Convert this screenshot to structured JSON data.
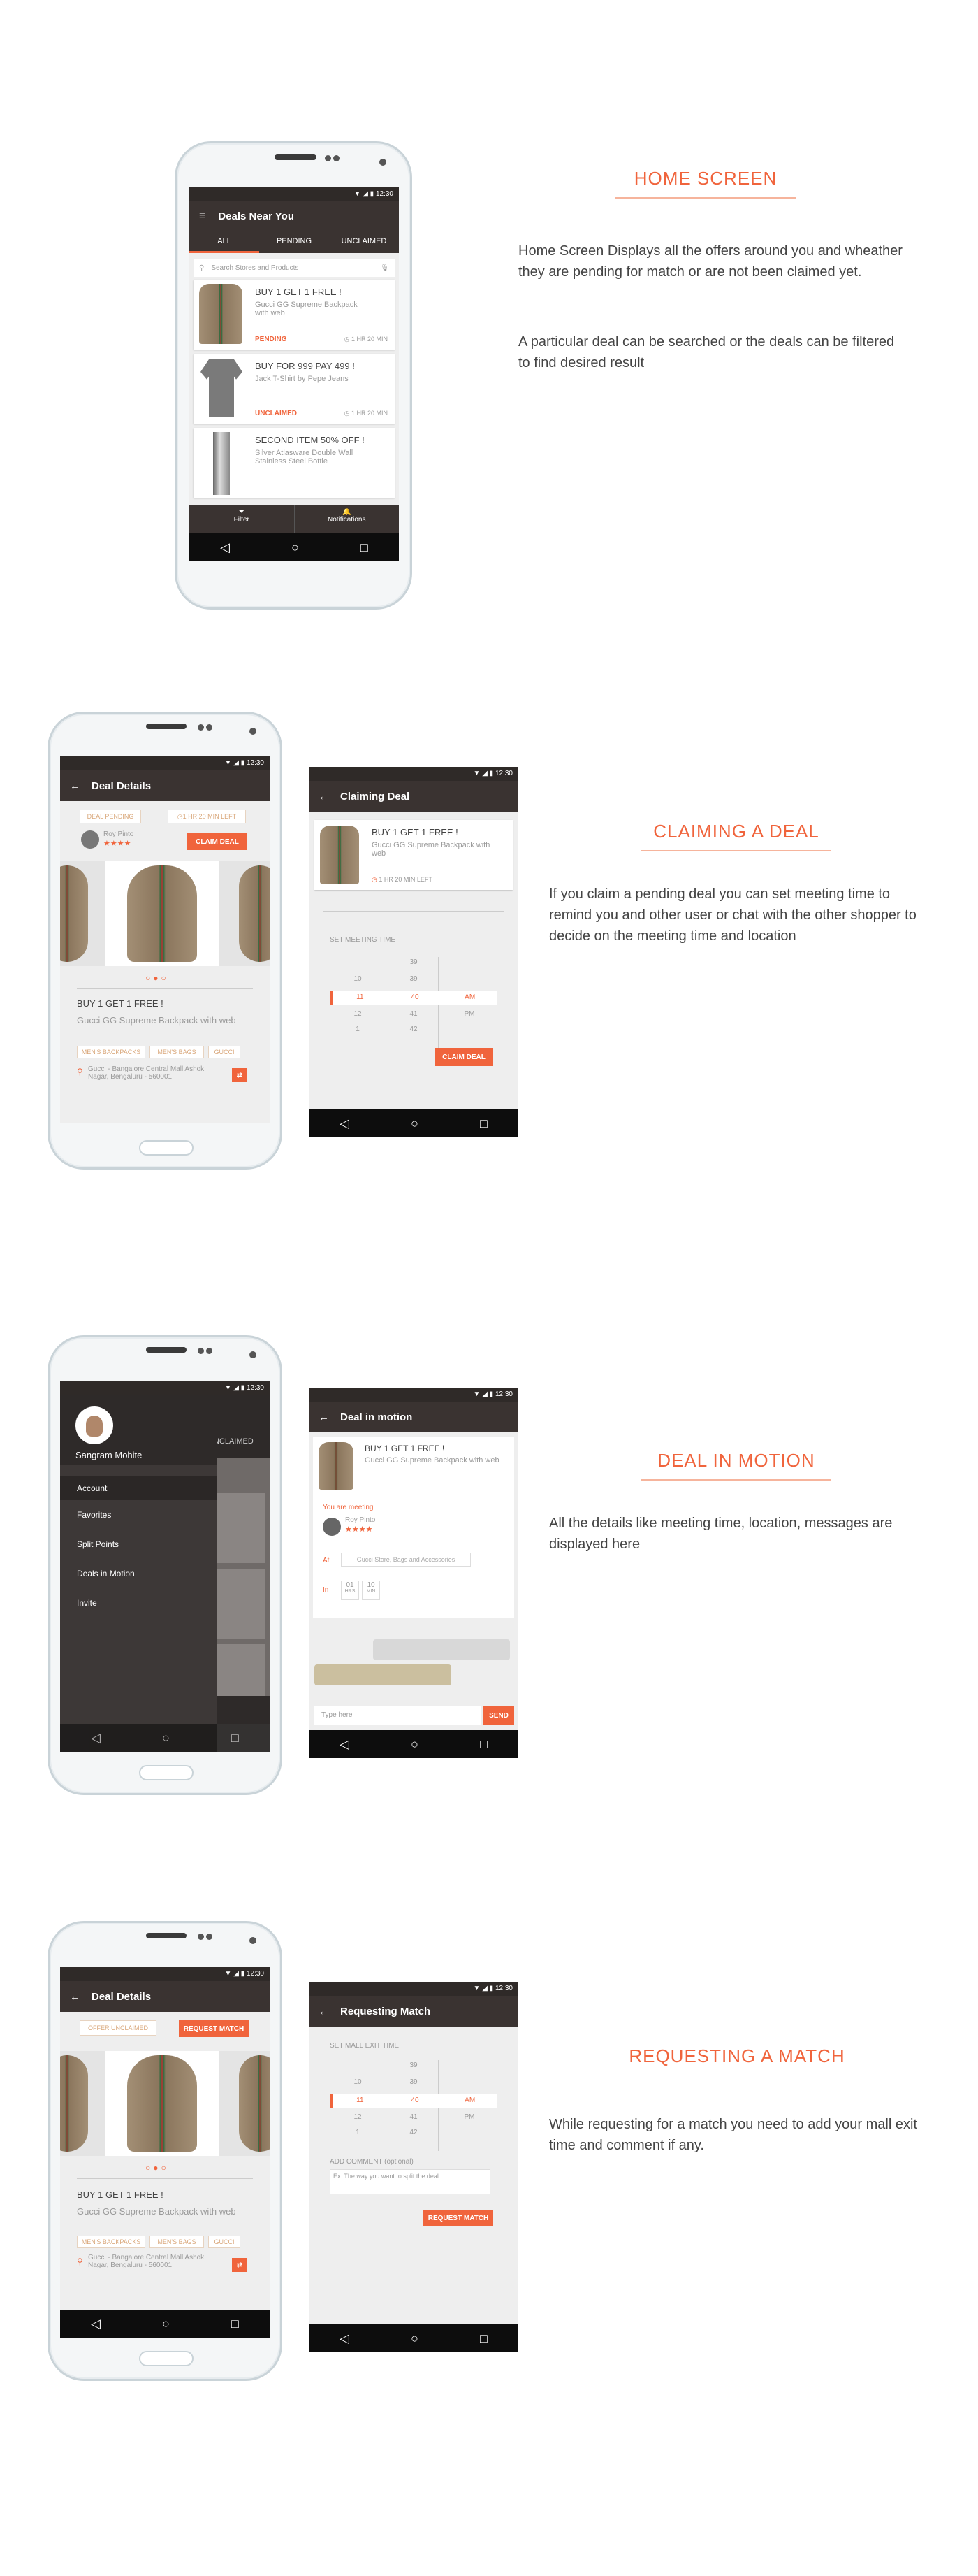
{
  "sections": {
    "home": {
      "title": "HOME SCREEN",
      "p1": "Home Screen Displays all the offers around you and wheather they are pending for match or are not been claimed yet.",
      "p2": "A particular deal can be searched or the deals can be filtered to find desired result"
    },
    "claim": {
      "title": "CLAIMING A DEAL",
      "p1": "If you claim a pending deal you can set meeting time to remind you and other user or chat with the other shopper to decide on the meeting time and location"
    },
    "motion": {
      "title": "DEAL IN MOTION",
      "p1": "All the details like meeting time, location, messages are displayed here"
    },
    "request": {
      "title": "REQUESTING A MATCH",
      "p1": "While requesting for a match you need to add your mall exit time and comment if any."
    }
  },
  "status_time": "12:30",
  "home_screen": {
    "title": "Deals Near You",
    "tabs": [
      "ALL",
      "PENDING",
      "UNCLAIMED"
    ],
    "search_placeholder": "Search Stores and Products",
    "deals": [
      {
        "title": "BUY 1 GET 1 FREE !",
        "desc": "Gucci GG Supreme Backpack with web",
        "status": "PENDING",
        "time": "1 HR 20 MIN"
      },
      {
        "title": "BUY FOR 999 PAY 499 !",
        "desc": "Jack T-Shirt by Pepe Jeans",
        "status": "UNCLAIMED",
        "time": "1 HR 20 MIN"
      },
      {
        "title": "SECOND ITEM 50% OFF !",
        "desc": "Silver Atlasware Double Wall Stainless Steel Bottle",
        "status": "",
        "time": ""
      }
    ],
    "filter": "Filter",
    "notifications": "Notifications"
  },
  "deal_details": {
    "title": "Deal Details",
    "status": "DEAL PENDING",
    "time_left": "1 HR 20 MIN LEFT",
    "user": "Roy Pinto",
    "rating": "★★★★",
    "claim": "CLAIM DEAL",
    "deal_title": "BUY 1 GET 1 FREE !",
    "product": "Gucci GG Supreme Backpack with web",
    "tags": [
      "MEN'S BACKPACKS",
      "MEN'S BAGS",
      "GUCCI"
    ],
    "location": "Gucci - Bangalore Central Mall Ashok Nagar, Bengaluru - 560001"
  },
  "claiming": {
    "title": "Claiming Deal",
    "deal_title": "BUY 1 GET 1 FREE !",
    "product": "Gucci GG Supreme Backpack with web",
    "time_left": "1 HR 20 MIN LEFT",
    "set_time": "SET MEETING TIME",
    "picker": [
      [
        "",
        "39",
        ""
      ],
      [
        "10",
        "39",
        ""
      ],
      [
        "11",
        "40",
        "AM"
      ],
      [
        "12",
        "41",
        "PM"
      ],
      [
        "1",
        "42",
        ""
      ]
    ],
    "button": "CLAIM DEAL"
  },
  "drawer": {
    "name": "Sangram Mohite",
    "items": [
      "Account",
      "Favorites",
      "Split Points",
      "Deals in Motion",
      "Invite"
    ]
  },
  "motion": {
    "title": "Deal in motion",
    "deal_title": "BUY 1 GET 1 FREE !",
    "product": "Gucci GG Supreme Backpack with web",
    "meeting": "You are meeting",
    "user": "Roy Pinto",
    "rating": "★★★★",
    "at_label": "At",
    "location": "Gucci Store, Bags and Accessories",
    "in_label": "In",
    "time_h": "01",
    "time_m": "10",
    "time_h_unit": "HRS",
    "time_m_unit": "MIN",
    "type_placeholder": "Type here",
    "send": "SEND"
  },
  "request_details": {
    "title": "Deal Details",
    "status": "OFFER UNCLAIMED",
    "button": "REQUEST MATCH",
    "deal_title": "BUY 1 GET 1 FREE !",
    "product": "Gucci GG Supreme Backpack with web",
    "tags": [
      "MEN'S BACKPACKS",
      "MEN'S BAGS",
      "GUCCI"
    ],
    "location": "Gucci - Bangalore Central Mall Ashok Nagar, Bengaluru - 560001"
  },
  "requesting": {
    "title": "Requesting Match",
    "set_time": "SET MALL EXIT TIME",
    "picker": [
      [
        "",
        "39",
        ""
      ],
      [
        "10",
        "39",
        ""
      ],
      [
        "11",
        "40",
        "AM"
      ],
      [
        "12",
        "41",
        "PM"
      ],
      [
        "1",
        "42",
        ""
      ]
    ],
    "comment_label": "ADD COMMENT (optional)",
    "comment_placeholder": "Ex: The way you want to split the deal",
    "button": "REQUEST MATCH"
  },
  "colors": {
    "accent": "#f0643c",
    "appbar": "#3a3331"
  }
}
